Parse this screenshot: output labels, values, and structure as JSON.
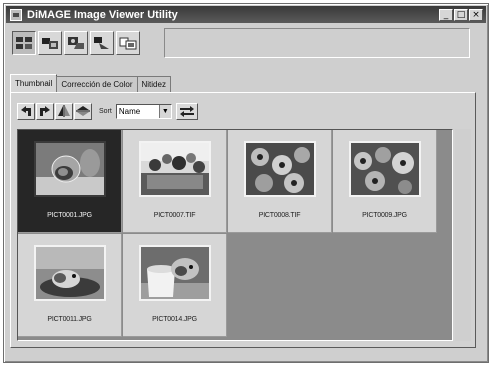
{
  "window": {
    "title": "DiMAGE Image Viewer Utility",
    "controls": {
      "minimize": "_",
      "maximize": "□",
      "close": "×"
    }
  },
  "toolbar": {
    "buttons": [
      {
        "icon": "thumbnail-view-icon",
        "pressed": true
      },
      {
        "icon": "color-correction-icon",
        "pressed": false
      },
      {
        "icon": "color-tone-icon",
        "pressed": false
      },
      {
        "icon": "sharpness-icon",
        "pressed": false
      },
      {
        "icon": "print-icon",
        "pressed": false
      }
    ]
  },
  "tabs": [
    {
      "label": "Thumbnail",
      "active": true
    },
    {
      "label": "Corrección de Color",
      "active": false
    },
    {
      "label": "Nitidez",
      "active": false
    }
  ],
  "panel_toolbar": {
    "rotate_left_icon": "rotate-left-icon",
    "rotate_right_icon": "rotate-right-icon",
    "flip_horizontal_icon": "flip-horizontal-icon",
    "flip_vertical_icon": "flip-vertical-icon",
    "sort_label": "Sort",
    "sort_value": "Name",
    "sort_order_icon": "sort-order-icon"
  },
  "thumbnails": [
    {
      "filename": "PICT0001.JPG",
      "selected": true,
      "subject": "hamster"
    },
    {
      "filename": "PICT0007.TIF",
      "selected": false,
      "subject": "flowers-pot"
    },
    {
      "filename": "PICT0008.TIF",
      "selected": false,
      "subject": "pansies"
    },
    {
      "filename": "PICT0009.JPG",
      "selected": false,
      "subject": "pansies"
    },
    {
      "filename": "PICT0011.JPG",
      "selected": false,
      "subject": "hamster-bowl"
    },
    {
      "filename": "PICT0014.JPG",
      "selected": false,
      "subject": "hamster-cup"
    }
  ]
}
